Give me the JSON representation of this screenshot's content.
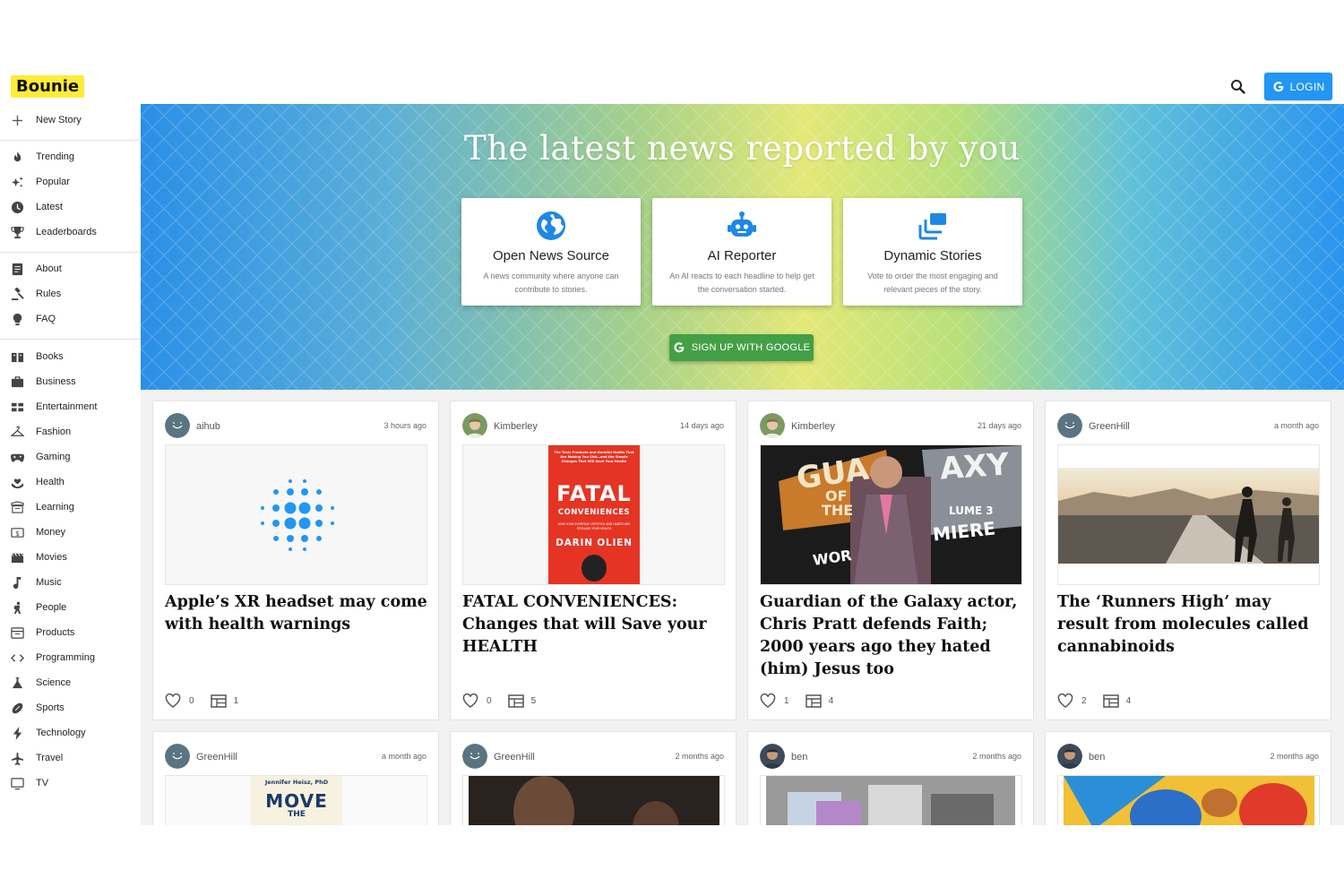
{
  "header": {
    "logo": "Bounie",
    "login_label": "LOGIN"
  },
  "sidebar": {
    "new_story": "New Story",
    "items": [
      {
        "label": "Trending",
        "icon": "fire-icon"
      },
      {
        "label": "Popular",
        "icon": "sparkle-icon"
      },
      {
        "label": "Latest",
        "icon": "clock-icon"
      },
      {
        "label": "Leaderboards",
        "icon": "trophy-icon"
      },
      {
        "label": "About",
        "icon": "document-icon"
      },
      {
        "label": "Rules",
        "icon": "gavel-icon"
      },
      {
        "label": "FAQ",
        "icon": "lightbulb-icon"
      },
      {
        "label": "Books",
        "icon": "book-icon"
      },
      {
        "label": "Business",
        "icon": "briefcase-icon"
      },
      {
        "label": "Entertainment",
        "icon": "theater-icon"
      },
      {
        "label": "Fashion",
        "icon": "hanger-icon"
      },
      {
        "label": "Gaming",
        "icon": "gamepad-icon"
      },
      {
        "label": "Health",
        "icon": "heart-hand-icon"
      },
      {
        "label": "Learning",
        "icon": "school-icon"
      },
      {
        "label": "Money",
        "icon": "money-icon"
      },
      {
        "label": "Movies",
        "icon": "movie-icon"
      },
      {
        "label": "Music",
        "icon": "music-note-icon"
      },
      {
        "label": "People",
        "icon": "person-icon"
      },
      {
        "label": "Products",
        "icon": "products-icon"
      },
      {
        "label": "Programming",
        "icon": "code-icon"
      },
      {
        "label": "Science",
        "icon": "flask-icon"
      },
      {
        "label": "Sports",
        "icon": "football-icon"
      },
      {
        "label": "Technology",
        "icon": "bolt-icon"
      },
      {
        "label": "Travel",
        "icon": "airplane-icon"
      },
      {
        "label": "TV",
        "icon": "tv-icon"
      }
    ]
  },
  "hero": {
    "title": "The latest news reported by you",
    "features": [
      {
        "title": "Open News Source",
        "desc": "A news community where anyone can contribute to stories.",
        "icon": "globe-icon"
      },
      {
        "title": "AI Reporter",
        "desc": "An AI reacts to each headline to help get the conversation started.",
        "icon": "robot-icon"
      },
      {
        "title": "Dynamic Stories",
        "desc": "Vote to order the most engaging and relevant pieces of the story.",
        "icon": "layers-icon"
      }
    ],
    "signup_label": "SIGN UP WITH GOOGLE"
  },
  "cards": [
    {
      "user": "aihub",
      "time": "3 hours ago",
      "title": "Apple’s XR headset may come with health warnings",
      "likes": "0",
      "stories": "1"
    },
    {
      "user": "Kimberley",
      "time": "14 days ago",
      "title": "FATAL CONVENIENCES: Changes that will Save your HEALTH",
      "likes": "0",
      "stories": "5",
      "image_text": {
        "tagline": "The Toxic Products and Harmful Habits That Are Making You Sick—and the Simple Changes That Will Save Your Health",
        "big1": "FATAL",
        "big2": "CONVENIENCES",
        "small": "HOW YOUR EVERYDAY LIFESTYLE AND HABITS ARE STEALING YOUR HEALTH",
        "author": "DARIN OLIEN"
      }
    },
    {
      "user": "Kimberley",
      "time": "21 days ago",
      "title": "Guardian of the Galaxy actor, Chris Pratt defends Faith; 2000 years ago they hated (him) Jesus too",
      "likes": "1",
      "stories": "4",
      "image_text": {
        "a": "GUA",
        "b": "AXY",
        "c": "OF",
        "d": "THE",
        "e": "LUME 3",
        "f": "MIERE",
        "g": "WOR"
      }
    },
    {
      "user": "GreenHill",
      "time": "a month ago",
      "title": "The ‘Runners High’ may result from molecules called cannabinoids",
      "likes": "2",
      "stories": "4"
    },
    {
      "user": "GreenHill",
      "time": "a month ago",
      "image_text": {
        "author": "Jennifer Heisz, PhD",
        "big": "MOVE",
        "small": "THE"
      }
    },
    {
      "user": "GreenHill",
      "time": "2 months ago"
    },
    {
      "user": "ben",
      "time": "2 months ago"
    },
    {
      "user": "ben",
      "time": "2 months ago"
    }
  ],
  "colors": {
    "accent": "#2196f3",
    "signup": "#43a047",
    "logo_bg": "#ffeb3b"
  }
}
